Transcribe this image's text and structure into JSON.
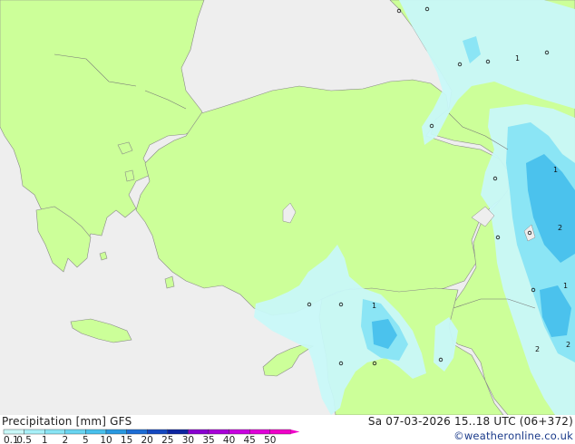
{
  "footer": {
    "title": "Precipitation [mm]  GFS",
    "valid": "Sa 07-03-2026 15..18 UTC (06+372)",
    "credit": "©weatheronline.co.uk"
  },
  "colorbar": {
    "labels": [
      "0.1",
      "0.5",
      "1",
      "2",
      "5",
      "10",
      "15",
      "20",
      "25",
      "30",
      "35",
      "40",
      "45",
      "50"
    ],
    "colors": [
      "#c8f8f8",
      "#a8f0f8",
      "#88e4f4",
      "#68d4f0",
      "#48c0ec",
      "#2898e0",
      "#1c6cd4",
      "#1448c0",
      "#0c24a0",
      "#8800d0",
      "#a800d8",
      "#c800e0",
      "#e000d8",
      "#f000c8"
    ]
  },
  "map_labels": [
    "1",
    "2",
    "2",
    "1",
    "2",
    "1",
    "0"
  ],
  "colors": {
    "land": "#ccff99",
    "sea": "#eeeeee",
    "rain_light": "#c8f8f8",
    "rain_mid": "#88e4f4",
    "rain_heavy": "#48c0ec"
  }
}
